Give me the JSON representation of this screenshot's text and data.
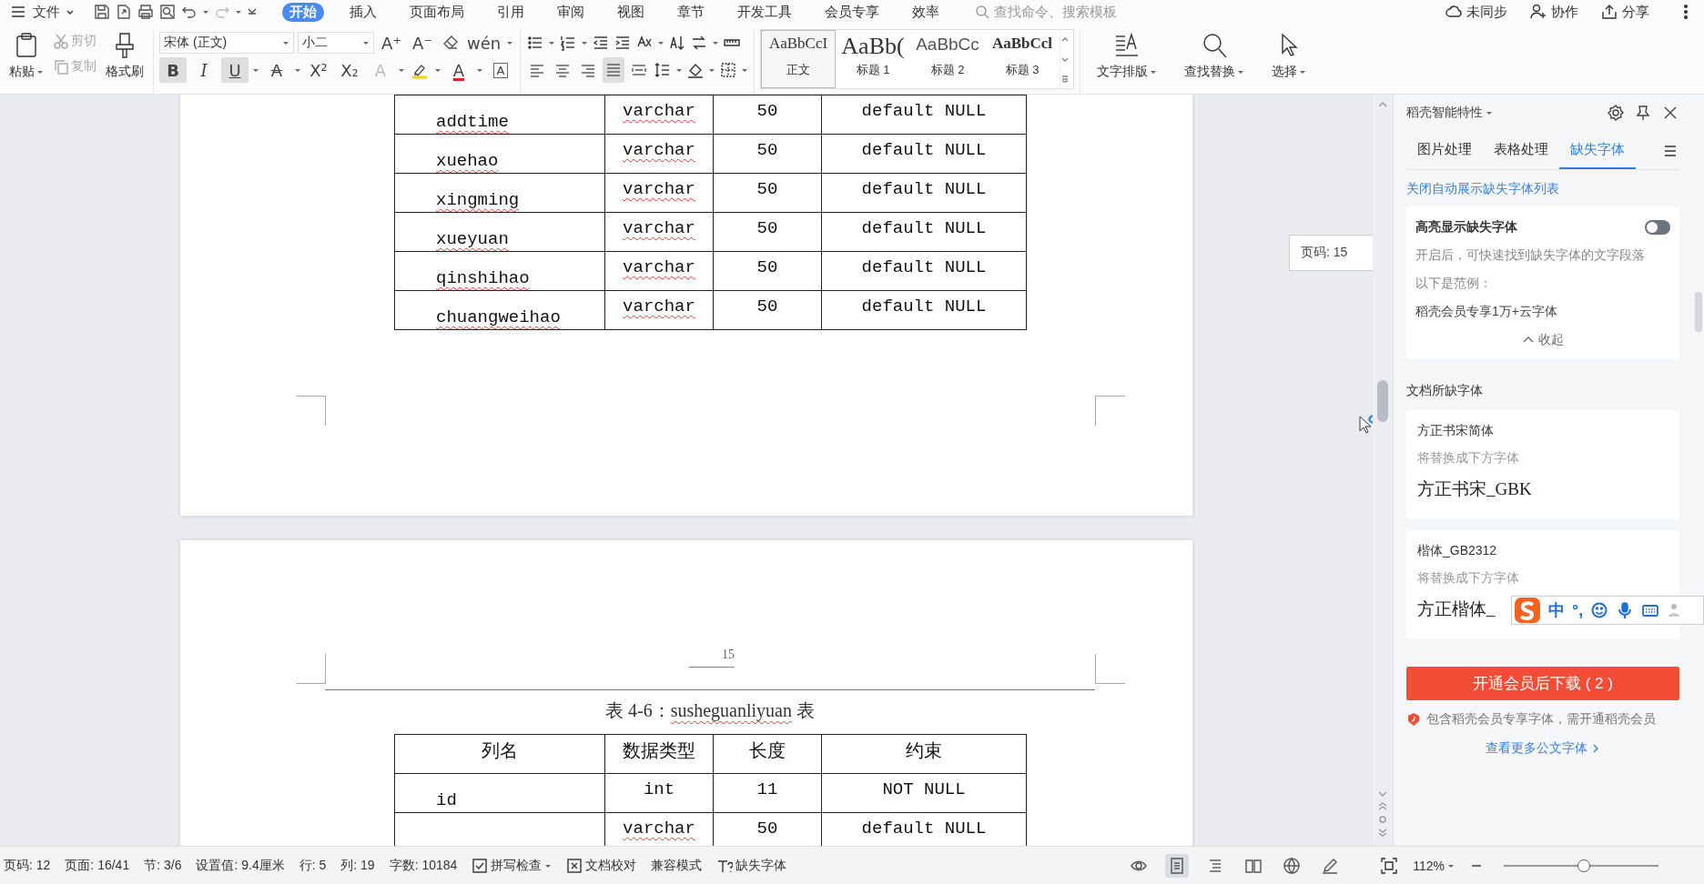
{
  "menu_bar": {
    "file": "文件",
    "tabs": [
      {
        "label": "开始",
        "selected": true
      },
      {
        "label": "插入",
        "selected": false
      },
      {
        "label": "页面布局",
        "selected": false
      },
      {
        "label": "引用",
        "selected": false
      },
      {
        "label": "审阅",
        "selected": false
      },
      {
        "label": "视图",
        "selected": false
      },
      {
        "label": "章节",
        "selected": false
      },
      {
        "label": "开发工具",
        "selected": false
      },
      {
        "label": "会员专享",
        "selected": false
      },
      {
        "label": "效率",
        "selected": false
      }
    ],
    "search": {
      "placeholder": "查找命令、搜索模板"
    },
    "actions": [
      {
        "kind": "sync",
        "label": "未同步"
      },
      {
        "kind": "collab",
        "label": "协作"
      },
      {
        "kind": "share",
        "label": "分享"
      }
    ]
  },
  "ribbon": {
    "paste": "粘贴",
    "clip_actions": [
      {
        "kind": "cut",
        "label": "剪切",
        "disabled": true
      },
      {
        "kind": "copy",
        "label": "复制",
        "disabled": true
      }
    ],
    "format_painter": "格式刷",
    "font": {
      "family": "宋体 (正文)",
      "size": "小二"
    },
    "font_tools": [
      {
        "glyph": "A⁺"
      },
      {
        "glyph": "A⁻"
      },
      {
        "kind": "eraser"
      },
      {
        "glyph": "wén"
      }
    ],
    "format_buttons": [
      {
        "kind": "bold",
        "glyph": "B",
        "on": true
      },
      {
        "kind": "italic",
        "glyph": "I",
        "on": false
      },
      {
        "kind": "underline",
        "glyph": "U",
        "on": true
      },
      {
        "kind": "strike",
        "glyph": "A",
        "on": false
      },
      {
        "kind": "plain",
        "glyph": "X²",
        "on": false
      },
      {
        "kind": "plain",
        "glyph": "X₂",
        "on": false
      },
      {
        "kind": "effect",
        "glyph": "A",
        "on": false
      },
      {
        "kind": "highlight",
        "on": false
      },
      {
        "kind": "color",
        "glyph": "A",
        "on": false
      },
      {
        "kind": "boxed",
        "glyph": "A",
        "on": false
      }
    ],
    "paragraph_align": [
      {
        "selected": false
      },
      {
        "selected": false
      },
      {
        "selected": false
      },
      {
        "selected": true
      },
      {
        "selected": false
      }
    ],
    "styles": [
      {
        "kind": "body",
        "preview": "AaBbCcI",
        "label": "正文",
        "selected": true
      },
      {
        "kind": "h1",
        "preview": "AaBb(",
        "label": "标题 1",
        "selected": false
      },
      {
        "kind": "h2",
        "preview": "AaBbCc",
        "label": "标题 2",
        "selected": false
      },
      {
        "kind": "h3",
        "preview": "AaBbCcl",
        "label": "标题 3",
        "selected": false
      }
    ],
    "tools": [
      {
        "kind": "layout",
        "label": "文字排版"
      },
      {
        "kind": "find",
        "label": "查找替换"
      },
      {
        "kind": "select",
        "label": "选择"
      }
    ]
  },
  "document": {
    "pages": [
      {
        "table": {
          "rows": [
            [
              {
                "text": "addtime",
                "misspelled": true
              },
              {
                "text": "varchar",
                "misspelled": true
              },
              {
                "text": "50",
                "misspelled": false
              },
              {
                "text": "default NULL",
                "misspelled": false
              }
            ],
            [
              {
                "text": "xuehao",
                "misspelled": true
              },
              {
                "text": "varchar",
                "misspelled": true
              },
              {
                "text": "50",
                "misspelled": false
              },
              {
                "text": "default NULL",
                "misspelled": false
              }
            ],
            [
              {
                "text": "xingming",
                "misspelled": true
              },
              {
                "text": "varchar",
                "misspelled": true
              },
              {
                "text": "50",
                "misspelled": false
              },
              {
                "text": "default NULL",
                "misspelled": false
              }
            ],
            [
              {
                "text": "xueyuan",
                "misspelled": true
              },
              {
                "text": "varchar",
                "misspelled": true
              },
              {
                "text": "50",
                "misspelled": false
              },
              {
                "text": "default NULL",
                "misspelled": false
              }
            ],
            [
              {
                "text": "qinshihao",
                "misspelled": true
              },
              {
                "text": "varchar",
                "misspelled": true
              },
              {
                "text": "50",
                "misspelled": false
              },
              {
                "text": "default NULL",
                "misspelled": false
              }
            ],
            [
              {
                "text": "chuangweihao",
                "misspelled": true
              },
              {
                "text": "varchar",
                "misspelled": true
              },
              {
                "text": "50",
                "misspelled": false
              },
              {
                "text": "default NULL",
                "misspelled": false
              }
            ]
          ]
        }
      },
      {
        "page_number": "15",
        "caption": [
          {
            "text": "表 4-6：",
            "misspelled": false
          },
          {
            "text": "susheguanliyuan",
            "misspelled": true
          },
          {
            "text": " 表",
            "misspelled": false
          }
        ],
        "table": {
          "header": [
            "列名",
            "数据类型",
            "长度",
            "约束"
          ],
          "rows": [
            [
              {
                "text": "id",
                "misspelled": false
              },
              {
                "text": "int",
                "misspelled": false
              },
              {
                "text": "11",
                "misspelled": false
              },
              {
                "text": "NOT NULL",
                "misspelled": false
              }
            ],
            [
              "",
              {
                "text": "varchar",
                "misspelled": true
              },
              {
                "text": "50",
                "misspelled": false
              },
              {
                "text": "default NULL",
                "misspelled": false
              }
            ]
          ]
        }
      }
    ]
  },
  "page_tooltip": "页码: 15",
  "side_panel": {
    "title": "稻壳智能特性",
    "tabs": [
      {
        "label": "图片处理",
        "selected": false
      },
      {
        "label": "表格处理",
        "selected": false
      },
      {
        "label": "缺失字体",
        "selected": true
      }
    ],
    "toggle_link": "关闭自动展示缺失字体列表",
    "highlight_card": {
      "title": "高亮显示缺失字体",
      "on": false,
      "description": "开启后，可快速找到缺失字体的文字段落",
      "example_label": "以下是范例：",
      "example": "稻壳会员专享1万+云字体",
      "collapse": "收起"
    },
    "missing_title": "文档所缺字体",
    "missing_fonts": [
      {
        "name": "方正书宋简体",
        "hint": "将替换成下方字体",
        "replacement": "方正书宋_GBK"
      },
      {
        "name": "楷体_GB2312",
        "hint": "将替换成下方字体",
        "replacement": "方正楷体_"
      }
    ],
    "download_button": "开通会员后下载 ( 2 )",
    "member_note": "包含稻壳会员专享字体，需开通稻壳会员",
    "more_link": "查看更多公文字体"
  },
  "ime_bar": {
    "mode": "中",
    "punct": "°,"
  },
  "status_bar": {
    "items": [
      {
        "kind": "text",
        "label": "页码: 12"
      },
      {
        "kind": "text",
        "label": "页面: 16/41"
      },
      {
        "kind": "text",
        "label": "节: 3/6"
      },
      {
        "kind": "text",
        "label": "设置值: 9.4厘米"
      },
      {
        "kind": "text",
        "label": "行: 5"
      },
      {
        "kind": "text",
        "label": "列: 19"
      },
      {
        "kind": "text",
        "label": "字数: 10184"
      },
      {
        "kind": "spell",
        "label": "拼写检查"
      },
      {
        "kind": "proof",
        "label": "文档校对"
      },
      {
        "kind": "text",
        "label": "兼容模式"
      },
      {
        "kind": "font",
        "label": "缺失字体"
      }
    ],
    "view_modes": [
      {
        "kind": "eye",
        "selected": false
      },
      {
        "kind": "page",
        "selected": true
      },
      {
        "kind": "outline",
        "selected": false
      },
      {
        "kind": "book",
        "selected": false
      },
      {
        "kind": "web",
        "selected": false
      },
      {
        "kind": "pen",
        "selected": false
      }
    ],
    "zoom": "112%",
    "zoom_slider": {
      "level": 0.52
    }
  }
}
